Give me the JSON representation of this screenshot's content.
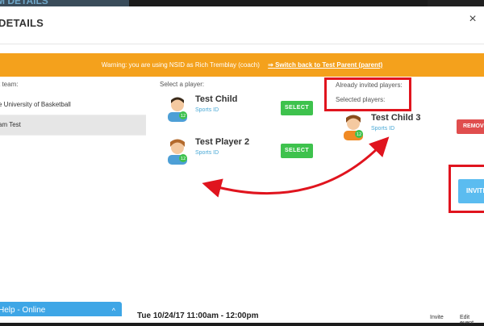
{
  "modal": {
    "title": "DETAILS",
    "close_icon": "×"
  },
  "backdrop": {
    "left_fragment": "M DETAILS"
  },
  "warning": {
    "text": "Warning: you are using NSID as Rich Tremblay (coach)",
    "link_icon": "⇒",
    "link": "Switch back to Test Parent (parent)"
  },
  "left": {
    "label": "t team:",
    "teams": [
      {
        "label": "e University of Basketball",
        "selected": false
      },
      {
        "label": "am Test",
        "selected": true
      }
    ]
  },
  "middle": {
    "label": "Select a player:",
    "players": [
      {
        "name": "Test Child",
        "sub": "Sports ID",
        "badge": "12",
        "button": "SELECT"
      },
      {
        "name": "Test Player 2",
        "sub": "Sports ID",
        "badge": "12",
        "button": "SELECT"
      }
    ]
  },
  "right": {
    "invited_label": "Already invited players:",
    "selected_label": "Selected players:",
    "player": {
      "name": "Test Child 3",
      "sub": "Sports ID",
      "badge": "12"
    },
    "remove_button": "REMOVE",
    "invite_button": "INVITE"
  },
  "help": {
    "label": "Help - Online",
    "chevron": "^"
  },
  "footer": {
    "date": "Tue 10/24/17 11:00am - 12:00pm",
    "invite": "Invite",
    "edit": "Edit event"
  },
  "colors": {
    "warning": "#f4a11c",
    "select": "#3ec24d",
    "remove": "#e04e4e",
    "invite": "#5bbcf0",
    "help": "#3ea6e6",
    "highlight": "#e0141e"
  }
}
